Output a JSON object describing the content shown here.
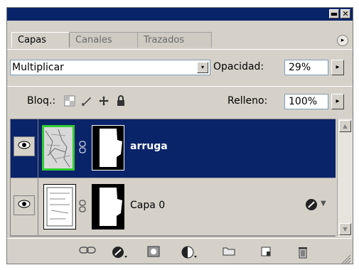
{
  "window": {
    "minimize_label": "▬",
    "close_label": "✕"
  },
  "tabs": [
    {
      "label": "Capas",
      "active": true
    },
    {
      "label": "Canales",
      "active": false
    },
    {
      "label": "Trazados",
      "active": false
    }
  ],
  "palette_menu_icon": "▸",
  "blend": {
    "value": "Multiplicar",
    "dropdown_icon": "▾"
  },
  "opacity": {
    "label": "Opacidad:",
    "value": "29%",
    "arrow": "▸"
  },
  "lock": {
    "label": "Bloq.:"
  },
  "fill": {
    "label": "Relleno:",
    "value": "100%",
    "arrow": "▸"
  },
  "layers": [
    {
      "name": "arruga",
      "selected": true,
      "visible": true
    },
    {
      "name": "Capa 0",
      "selected": false,
      "visible": true
    }
  ],
  "scroll": {
    "up": "▲",
    "down": "▼"
  },
  "colors": {
    "panel_bg": "#d5d1c9",
    "selection": "#0a246a",
    "thumb_border_active": "#33cc33"
  }
}
